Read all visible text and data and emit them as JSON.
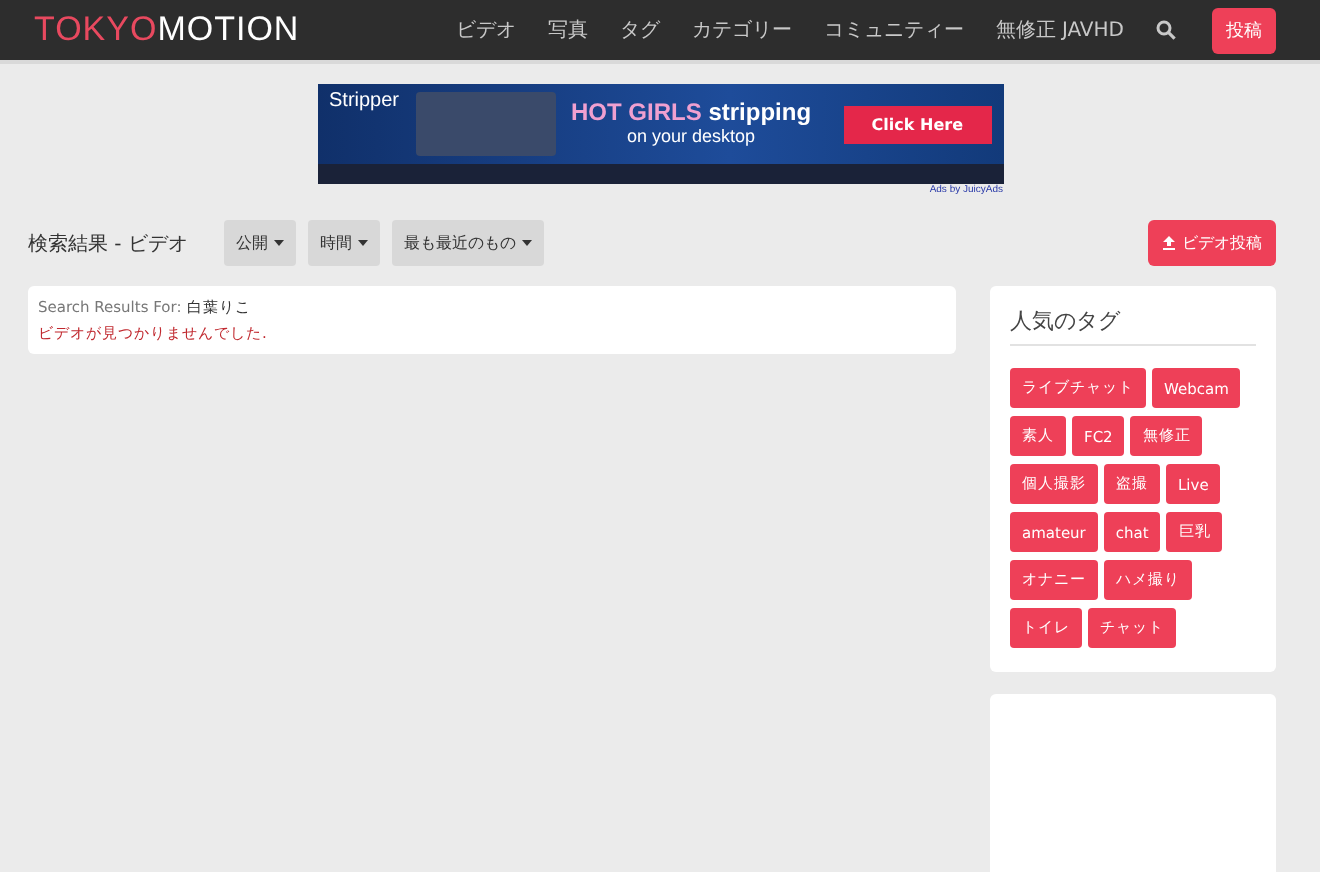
{
  "nav": {
    "logo_left": "TOKYO",
    "logo_right": "MOTION",
    "items": [
      "ビデオ",
      "写真",
      "タグ",
      "カテゴリー",
      "コミュニティー",
      "無修正 JAVHD"
    ],
    "post_button": "投稿"
  },
  "ad": {
    "brand": "Stripper",
    "headline_strong": "HOT GIRLS",
    "headline_rest": "stripping",
    "subline": "on your desktop",
    "cta": "Click Here",
    "credit": "Ads by JuicyAds"
  },
  "toolbar": {
    "title": "検索結果 - ビデオ",
    "filters": [
      "公開",
      "時間",
      "最も最近のもの"
    ],
    "upload_button": "ビデオ投稿"
  },
  "results": {
    "label": "Search Results For:",
    "query": "白葉りこ",
    "message": "ビデオが見つかりませんでした."
  },
  "sidebar": {
    "title": "人気のタグ",
    "tags": [
      "ライブチャット",
      "Webcam",
      "素人",
      "FC2",
      "無修正",
      "個人撮影",
      "盗撮",
      "Live",
      "amateur",
      "chat",
      "巨乳",
      "オナニー",
      "ハメ撮り",
      "トイレ",
      "チャット"
    ]
  }
}
